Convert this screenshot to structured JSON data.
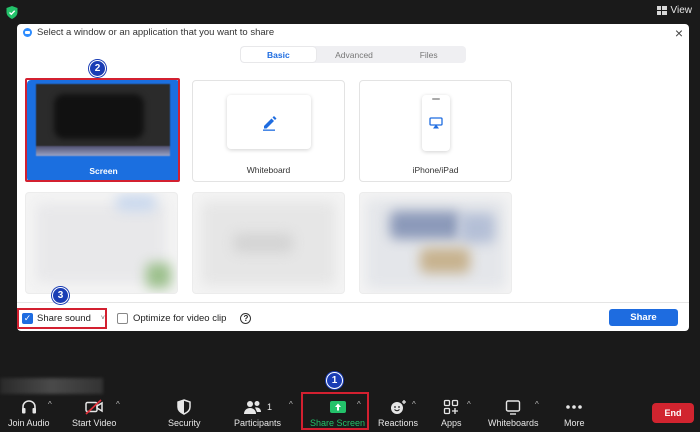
{
  "top_bar": {
    "view_label": "View"
  },
  "dialog": {
    "title": "Select a window or an application that you want to share",
    "close_glyph": "×",
    "tabs": [
      {
        "label": "Basic",
        "active": true
      },
      {
        "label": "Advanced",
        "active": false
      },
      {
        "label": "Files",
        "active": false
      }
    ],
    "tiles": [
      {
        "label": "Screen",
        "selected": true
      },
      {
        "label": "Whiteboard",
        "selected": false
      },
      {
        "label": "iPhone/iPad",
        "selected": false
      }
    ],
    "share_sound": {
      "label": "Share sound",
      "checked": true,
      "caret": "˅"
    },
    "optimize": {
      "label": "Optimize for video clip",
      "checked": false,
      "help": "?"
    },
    "share_button": "Share"
  },
  "callouts": {
    "n1": "1",
    "n2": "2",
    "n3": "3"
  },
  "toolbar": {
    "items": [
      {
        "label": "Join Audio",
        "icon": "headphones-icon"
      },
      {
        "label": "Start Video",
        "icon": "video-off-icon"
      },
      {
        "label": "Security",
        "icon": "shield-icon"
      },
      {
        "label": "Participants",
        "icon": "participants-icon",
        "count": "1"
      },
      {
        "label": "Share Screen",
        "icon": "share-screen-icon"
      },
      {
        "label": "Reactions",
        "icon": "emoji-icon"
      },
      {
        "label": "Apps",
        "icon": "apps-icon"
      },
      {
        "label": "Whiteboards",
        "icon": "whiteboard-icon"
      },
      {
        "label": "More",
        "icon": "more-icon"
      }
    ],
    "caret": "^",
    "end_label": "End"
  },
  "colors": {
    "accent": "#1e6ce0",
    "highlight": "#d32030",
    "callout": "#1a3db5",
    "end": "#d1242f",
    "share_green": "#23c26a"
  }
}
